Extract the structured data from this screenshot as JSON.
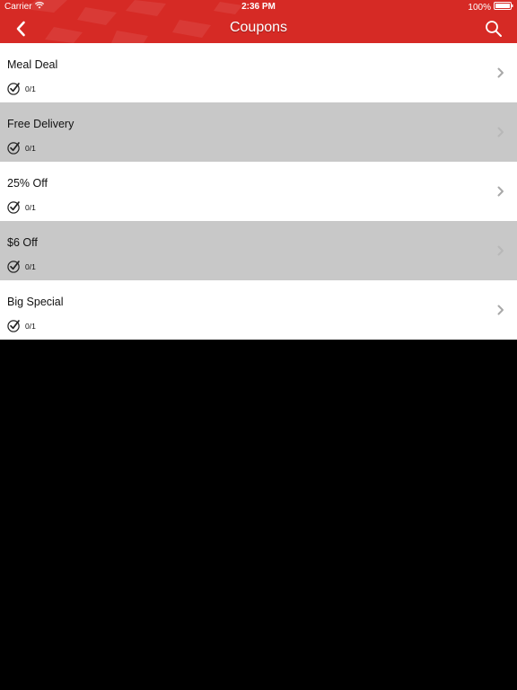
{
  "status_bar": {
    "carrier": "Carrier",
    "time": "2:36 PM",
    "battery": "100%"
  },
  "nav": {
    "title": "Coupons",
    "back_icon": "chevron-left-icon",
    "search_icon": "search-icon"
  },
  "colors": {
    "header_red": "#d62a25",
    "row_white": "#ffffff",
    "row_gray": "#c8c8c8",
    "background": "#000000"
  },
  "coupons": [
    {
      "title": "Meal Deal",
      "usage": "0/1"
    },
    {
      "title": "Free Delivery",
      "usage": "0/1"
    },
    {
      "title": "25% Off",
      "usage": "0/1"
    },
    {
      "title": "$6 Off",
      "usage": "0/1"
    },
    {
      "title": "Big Special",
      "usage": "0/1"
    }
  ]
}
